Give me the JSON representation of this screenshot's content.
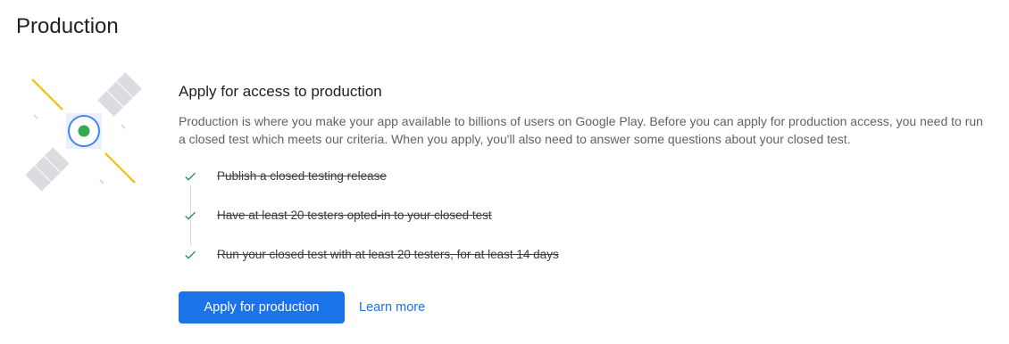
{
  "page": {
    "title": "Production"
  },
  "card": {
    "heading": "Apply for access to production",
    "description": "Production is where you make your app available to billions of users on Google Play. Before you can apply for production access, you need to run a closed test which meets our criteria. When you apply, you'll also need to answer some questions about your closed test.",
    "illustration_icon": "satellite-illustration",
    "checklist": [
      {
        "label": "Publish a closed testing release",
        "done": true,
        "icon": "check-icon"
      },
      {
        "label": "Have at least 20 testers opted-in to your closed test",
        "done": true,
        "icon": "check-icon"
      },
      {
        "label": "Run your closed test with at least 20 testers, for at least 14 days",
        "done": true,
        "icon": "check-icon"
      }
    ]
  },
  "actions": {
    "apply_label": "Apply for production",
    "learn_more_label": "Learn more"
  },
  "colors": {
    "primary": "#1a73e8",
    "check": "#1e8e3e",
    "satellite_body": "#dadce0",
    "satellite_accent": "#fbbc04",
    "satellite_dot": "#34a853",
    "satellite_ring": "#4285f4"
  }
}
